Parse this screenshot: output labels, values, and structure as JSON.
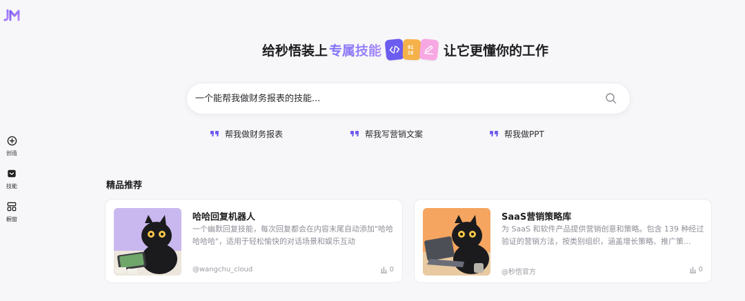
{
  "sidebar": {
    "logo": "JM",
    "items": [
      {
        "label": "创造",
        "icon": "plus-circle-icon"
      },
      {
        "label": "技能",
        "icon": "skill-box-icon"
      },
      {
        "label": "橱窗",
        "icon": "grid-icon"
      }
    ]
  },
  "hero": {
    "title_prefix": "给秒悟装上",
    "title_accent": "专属技能",
    "title_suffix": "让它更懂你的工作",
    "chips": [
      {
        "icon": "code-icon",
        "text": "</>",
        "color": "#6d5cf0"
      },
      {
        "icon": "binary-icon",
        "text": "01 10",
        "color": "#f6b24a"
      },
      {
        "icon": "pencil-icon",
        "text": "",
        "color": "#f7a8e3"
      }
    ]
  },
  "search": {
    "placeholder": "一个能帮我做财务报表的技能..."
  },
  "suggestions": [
    "帮我做财务报表",
    "帮我写营销文案",
    "帮我做PPT"
  ],
  "featured": {
    "title": "精品推荐",
    "cards": [
      {
        "title": "哈哈回复机器人",
        "description": "一个幽默回复技能，每次回复都会在内容末尾自动添加\"哈哈哈哈哈\"，适用于轻松愉快的对话场景和娱乐互动",
        "author": "@wangchu_cloud",
        "count": "0"
      },
      {
        "title": "SaaS营销策略库",
        "description": "为 SaaS 和软件产品提供营销创意和策略。包含 139 种经过验证的营销方法，按类别组织，涵盖增长策略、推广策...",
        "author": "@秒悟官方",
        "count": "0"
      }
    ]
  },
  "colors": {
    "accent": "#7b6cf6",
    "background": "#f7f7f9"
  }
}
